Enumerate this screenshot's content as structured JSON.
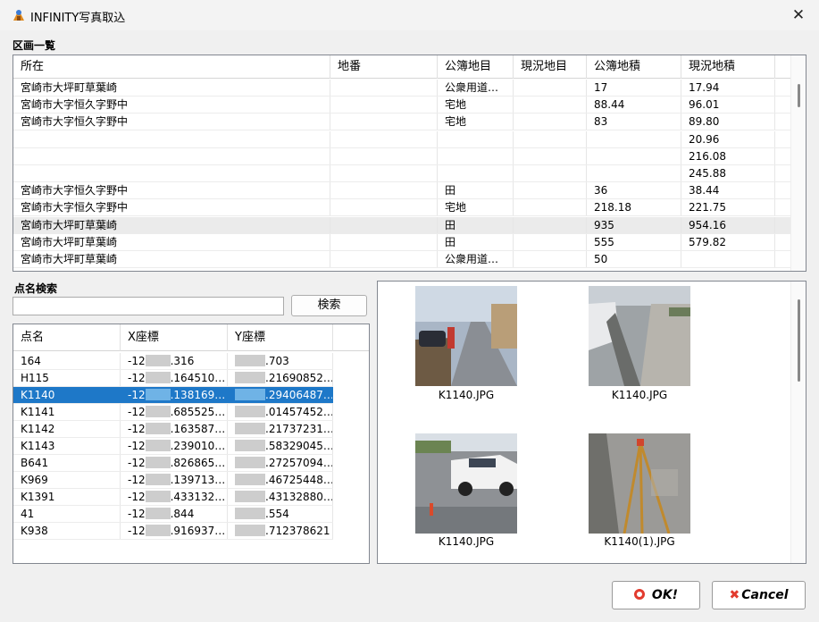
{
  "window": {
    "title": "INFINITY写真取込",
    "close": "✕"
  },
  "parcel_section": {
    "label": "区画一覧",
    "columns": [
      "所在",
      "地番",
      "公簿地目",
      "現況地目",
      "公簿地積",
      "現況地積"
    ],
    "rows": [
      [
        "宮崎市大坪町草葉崎",
        "",
        "公衆用道…",
        "",
        "17",
        "17.94"
      ],
      [
        "宮崎市大字恒久字野中",
        "",
        "宅地",
        "",
        "88.44",
        "96.01"
      ],
      [
        "宮崎市大字恒久字野中",
        "",
        "宅地",
        "",
        "83",
        "89.80"
      ],
      [
        "",
        "",
        "",
        "",
        "",
        "20.96"
      ],
      [
        "",
        "",
        "",
        "",
        "",
        "216.08"
      ],
      [
        "",
        "",
        "",
        "",
        "",
        "245.88"
      ],
      [
        "宮崎市大字恒久字野中",
        "",
        "田",
        "",
        "36",
        "38.44"
      ],
      [
        "宮崎市大字恒久字野中",
        "",
        "宅地",
        "",
        "218.18",
        "221.75"
      ],
      [
        "宮崎市大坪町草葉崎",
        "",
        "田",
        "",
        "935",
        "954.16"
      ],
      [
        "宮崎市大坪町草葉崎",
        "",
        "田",
        "",
        "555",
        "579.82"
      ],
      [
        "宮崎市大坪町草葉崎",
        "",
        "公衆用道…",
        "",
        "50",
        ""
      ]
    ]
  },
  "point_search": {
    "label": "点名検索",
    "query": "",
    "search_button": "検索",
    "columns": [
      "点名",
      "X座標",
      "Y座標"
    ],
    "rows": [
      [
        "164",
        "-12",
        ".316",
        "",
        ".703"
      ],
      [
        "H115",
        "-12",
        ".164510…",
        "",
        ".21690852…"
      ],
      [
        "K1140",
        "-12",
        ".138169…",
        "",
        ".29406487…"
      ],
      [
        "K1141",
        "-12",
        ".685525…",
        "",
        ".01457452…"
      ],
      [
        "K1142",
        "-12",
        ".163587…",
        "",
        ".21737231…"
      ],
      [
        "K1143",
        "-12",
        ".239010…",
        "",
        ".58329045…"
      ],
      [
        "B641",
        "-12",
        ".826865…",
        "",
        ".27257094…"
      ],
      [
        "K969",
        "-12",
        ".139713…",
        "",
        ".46725448…"
      ],
      [
        "K1391",
        "-12",
        ".433132…",
        "",
        ".43132880…"
      ],
      [
        "41",
        "-12",
        ".844",
        "",
        ".554"
      ],
      [
        "K938",
        "-12",
        ".916937…",
        "",
        ".712378621"
      ]
    ],
    "selected_index": 2
  },
  "photos": [
    {
      "caption": "K1140.JPG",
      "icon": "road-photo-thumbnail"
    },
    {
      "caption": "K1140.JPG",
      "icon": "curb-photo-thumbnail"
    },
    {
      "caption": "K1140.JPG",
      "icon": "car-photo-thumbnail"
    },
    {
      "caption": "K1140(1).JPG",
      "icon": "tripod-photo-thumbnail"
    }
  ],
  "footer": {
    "ok_label": "OK!",
    "cancel_label": "Cancel"
  },
  "colors": {
    "selection": "#1e78c8",
    "accent_red": "#e23b2e"
  }
}
